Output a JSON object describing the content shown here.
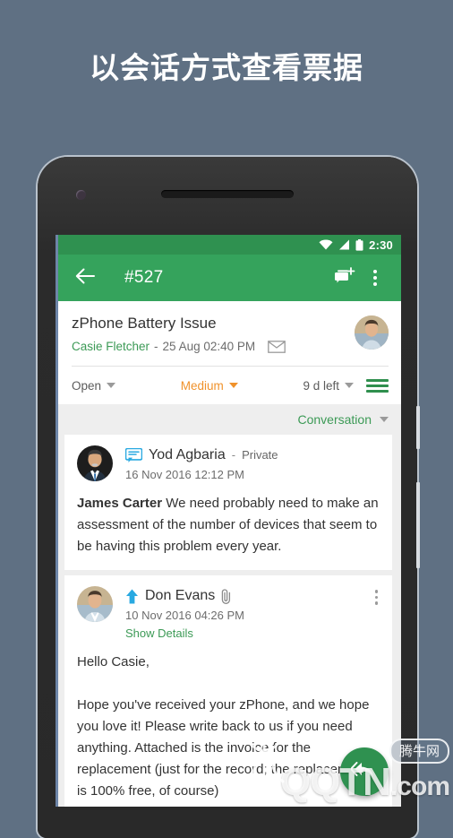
{
  "promo": {
    "heading": "以会话方式查看票据"
  },
  "device": {
    "camera_icon": "camera-dot",
    "earpiece_icon": "earpiece-speaker",
    "power_button": "power-button",
    "volume_button": "volume-button"
  },
  "status_bar": {
    "wifi_icon": "wifi-icon",
    "signal_icon": "cellular-signal-icon",
    "battery_icon": "battery-icon",
    "time": "2:30"
  },
  "action_bar": {
    "back_icon": "back-arrow-icon",
    "title": "#527",
    "add_note_icon": "add-note-icon",
    "overflow_icon": "overflow-menu-icon",
    "background": "#35a35c"
  },
  "ticket": {
    "subject": "zPhone Battery Issue",
    "requester": "Casie Fletcher",
    "separator": "-",
    "date": "25 Aug 02:40 PM",
    "channel_icon": "envelope-icon",
    "avatar_icon": "requester-avatar"
  },
  "properties": {
    "status": "Open",
    "priority": "Medium",
    "due": "9 d left",
    "priority_color": "#f0922b",
    "list_icon": "list-lines-icon"
  },
  "conversation_filter": {
    "label": "Conversation",
    "caret_icon": "chevron-down-icon"
  },
  "messages": [
    {
      "type_icon": "private-note-icon",
      "author": "Yod Agbaria",
      "separator": "-",
      "tag": "Private",
      "timestamp": "16 Nov 2016 12:12 PM",
      "body_prefix": "James Carter",
      "body": " We need probably need to make an assessment of the number of devices that seem to be having this problem every year.",
      "has_attachment": false,
      "show_details": null,
      "has_overflow": false
    },
    {
      "type_icon": "outgoing-reply-icon",
      "author": "Don Evans",
      "separator": null,
      "tag": null,
      "attachment_icon": "paperclip-icon",
      "timestamp": "10 Nov 2016 04:26 PM",
      "show_details": "Show Details",
      "body_prefix": null,
      "body": "Hello Casie,\n\nHope you've received your zPhone, and we hope you love it! Please write back to us if you need anything. Attached is the invoice for the replacement (just for the record; the replacement is 100% free, of course)",
      "has_attachment": true,
      "has_overflow": true,
      "overflow_icon": "overflow-menu-icon"
    }
  ],
  "fab": {
    "icon": "reply-icon",
    "color": "#2f9150"
  },
  "watermark": {
    "badge": "腾牛网",
    "site": "QQTN",
    "suffix": ".com"
  }
}
